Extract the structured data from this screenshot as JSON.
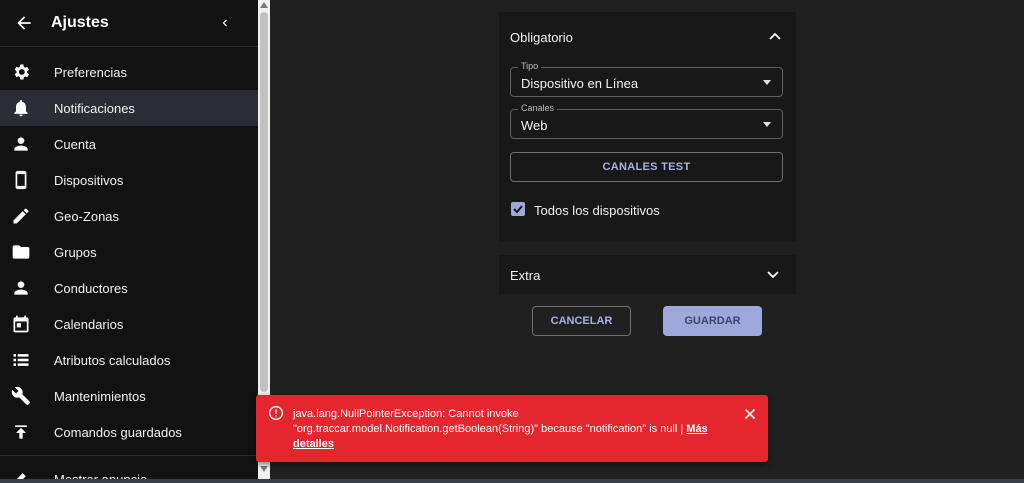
{
  "sidebar": {
    "title": "Ajustes",
    "items": [
      {
        "label": "Preferencias",
        "icon": "gear-icon"
      },
      {
        "label": "Notificaciones",
        "icon": "bell-icon"
      },
      {
        "label": "Cuenta",
        "icon": "person-icon"
      },
      {
        "label": "Dispositivos",
        "icon": "phone-icon"
      },
      {
        "label": "Geo-Zonas",
        "icon": "pencil-icon"
      },
      {
        "label": "Grupos",
        "icon": "folder-icon"
      },
      {
        "label": "Conductores",
        "icon": "person-icon"
      },
      {
        "label": "Calendarios",
        "icon": "calendar-icon"
      },
      {
        "label": "Atributos calculados",
        "icon": "list-icon"
      },
      {
        "label": "Mantenimientos",
        "icon": "wrench-icon"
      },
      {
        "label": "Comandos guardados",
        "icon": "upload-icon"
      }
    ],
    "partial_item": "Mostrar anuncio",
    "active_index": 1
  },
  "form": {
    "section_required": "Obligatorio",
    "type_label": "Tipo",
    "type_value": "Dispositivo en Línea",
    "channels_label": "Canales",
    "channels_value": "Web",
    "test_button": "CANALES TEST",
    "all_devices_label": "Todos los dispositivos",
    "all_devices_checked": true,
    "section_extra": "Extra",
    "cancel_button": "CANCELAR",
    "save_button": "GUARDAR"
  },
  "toast": {
    "message": "java.lang.NullPointerException: Cannot invoke \"org.traccar.model.Notification.getBoolean(String)\" because \"notification\" is null | ",
    "link": "Más detalles"
  },
  "colors": {
    "accent": "#9ea8db",
    "error": "#e5262f",
    "sidebar_bg": "#121212",
    "page_bg": "#202020"
  }
}
